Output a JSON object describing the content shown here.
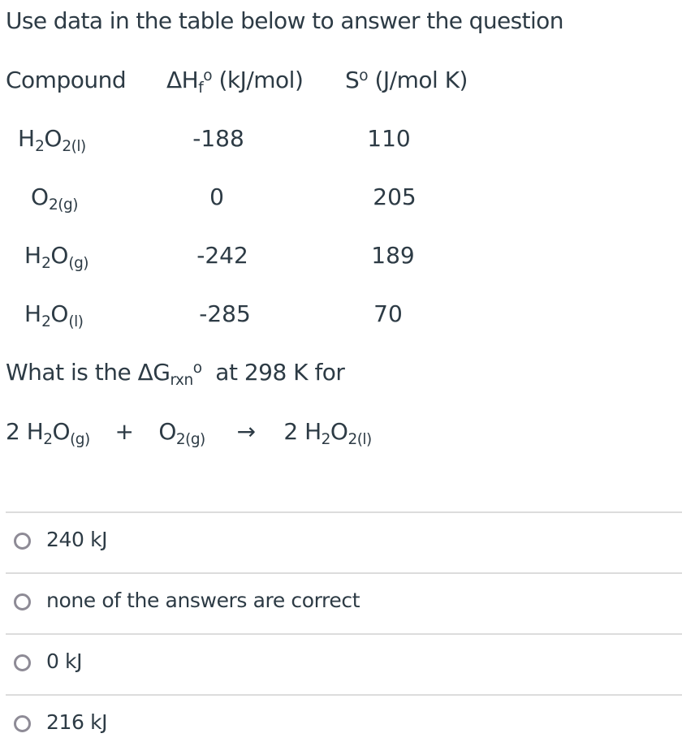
{
  "intro": "Use data in the table below to answer the question",
  "table": {
    "headers": {
      "compound": "Compound",
      "delta_h": {
        "prefix": "ΔH",
        "sub": "f",
        "sup": "o",
        "suffix": " (kJ/mol)"
      },
      "entropy": {
        "prefix": "S",
        "sup": "o",
        "suffix": " (J/mol K)"
      }
    },
    "rows": [
      {
        "compound": {
          "pre": "H",
          "sub1": "2",
          "mid": "O",
          "sub2": "2(l)"
        },
        "delta_h": "-188",
        "entropy": "110"
      },
      {
        "compound": {
          "pre": "",
          "sub1": "",
          "mid": "O",
          "sub2": "2(g)"
        },
        "delta_h": "0",
        "entropy": "205"
      },
      {
        "compound": {
          "pre": "H",
          "sub1": "2",
          "mid": "O",
          "sub2": "(g)"
        },
        "delta_h": "-242",
        "entropy": "189"
      },
      {
        "compound": {
          "pre": "H",
          "sub1": "2",
          "mid": "O",
          "sub2": "(l)"
        },
        "delta_h": "-285",
        "entropy": "70"
      }
    ]
  },
  "question": {
    "prefix": "What is the ΔG",
    "sub": "rxn",
    "sup": "o",
    "suffix": "  at 298 K for"
  },
  "equation": {
    "r1_coef": "2 H",
    "r1_sub1": "2",
    "r1_mid": "O",
    "r1_sub2": "(g)",
    "plus": "+",
    "r2_mid": "O",
    "r2_sub": "2(g)",
    "arrow": "→",
    "p1_coef": "2 H",
    "p1_sub1": "2",
    "p1_mid": "O",
    "p1_sub2": "2(l)"
  },
  "answers": [
    {
      "label": "240 kJ",
      "selected": false
    },
    {
      "label": "none of the answers are correct",
      "selected": false
    },
    {
      "label": "0 kJ",
      "selected": false
    },
    {
      "label": "216 kJ",
      "selected": false
    }
  ],
  "colors": {
    "text": "#2d3b45",
    "divider": "#dcdcdc",
    "radio_border": "#8e8b96"
  }
}
